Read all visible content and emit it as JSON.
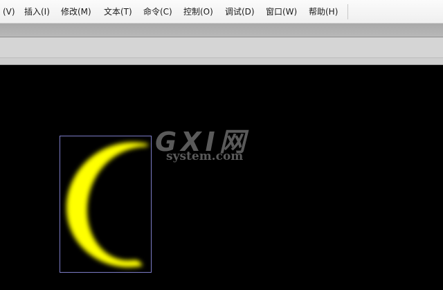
{
  "menubar": {
    "items": [
      {
        "label": "(V)"
      },
      {
        "label": "插入(I)"
      },
      {
        "label": "修改(M)"
      },
      {
        "label": "文本(T)"
      },
      {
        "label": "命令(C)"
      },
      {
        "label": "控制(O)"
      },
      {
        "label": "调试(D)"
      },
      {
        "label": "窗口(W)"
      },
      {
        "label": "帮助(H)"
      }
    ]
  },
  "watermark": {
    "logo": "GXI网",
    "sub": "system.com"
  },
  "stage": {
    "background": "#000000",
    "shape_color": "#ffff00",
    "selection_color": "#7d7dc8",
    "shape_icon": "crescent-moon-icon"
  }
}
